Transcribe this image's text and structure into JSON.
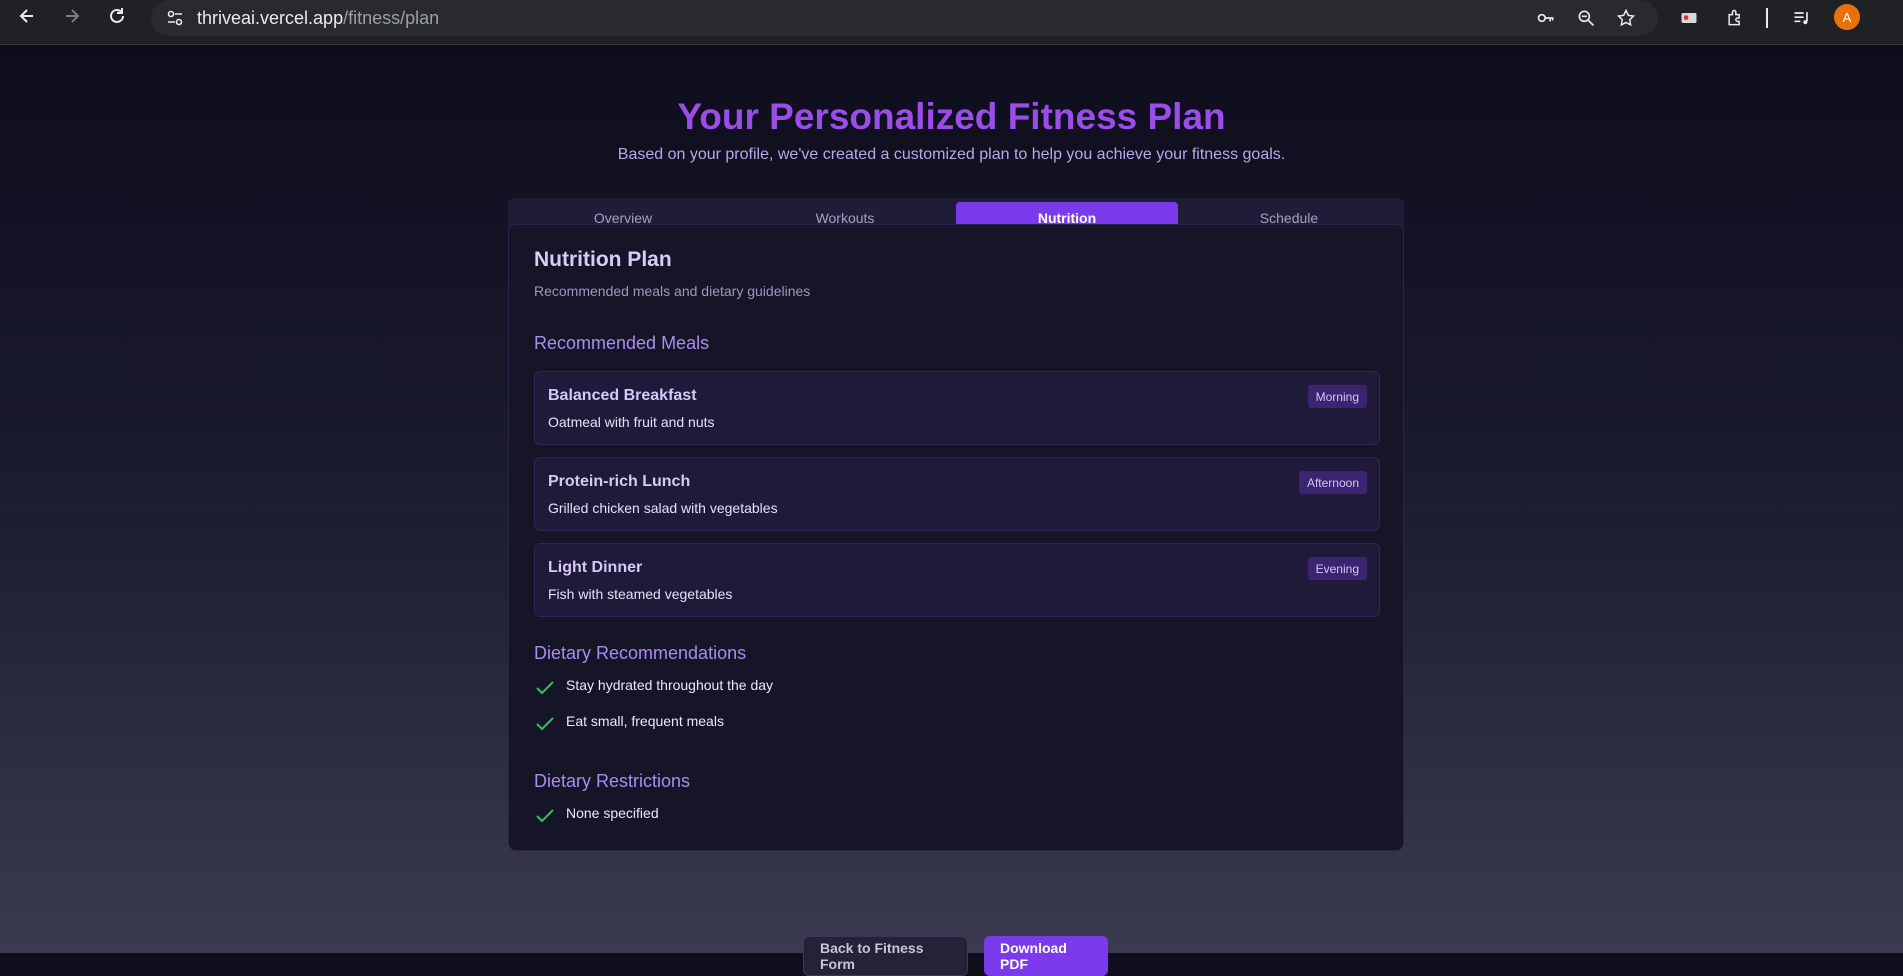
{
  "browser": {
    "url_host": "thriveai.vercel.app",
    "url_path": "/fitness/plan",
    "avatar_letter": "A"
  },
  "page": {
    "title": "Your Personalized Fitness Plan",
    "subtitle": "Based on your profile, we've created a customized plan to help you achieve your fitness goals."
  },
  "tabs": [
    {
      "label": "Overview",
      "active": false
    },
    {
      "label": "Workouts",
      "active": false
    },
    {
      "label": "Nutrition",
      "active": true
    },
    {
      "label": "Schedule",
      "active": false
    }
  ],
  "nutrition": {
    "title": "Nutrition Plan",
    "description": "Recommended meals and dietary guidelines",
    "meals_heading": "Recommended Meals",
    "meals": [
      {
        "name": "Balanced Breakfast",
        "description": "Oatmeal with fruit and nuts",
        "time": "Morning"
      },
      {
        "name": "Protein-rich Lunch",
        "description": "Grilled chicken salad with vegetables",
        "time": "Afternoon"
      },
      {
        "name": "Light Dinner",
        "description": "Fish with steamed vegetables",
        "time": "Evening"
      }
    ],
    "recommendations_heading": "Dietary Recommendations",
    "recommendations": [
      "Stay hydrated throughout the day",
      "Eat small, frequent meals"
    ],
    "restrictions_heading": "Dietary Restrictions",
    "restrictions": [
      "None specified"
    ]
  },
  "actions": {
    "back_label": "Back to Fitness Form",
    "download_label": "Download PDF"
  },
  "colors": {
    "accent": "#7c3aed",
    "title": "#9b4de8",
    "check": "#22c55e"
  }
}
